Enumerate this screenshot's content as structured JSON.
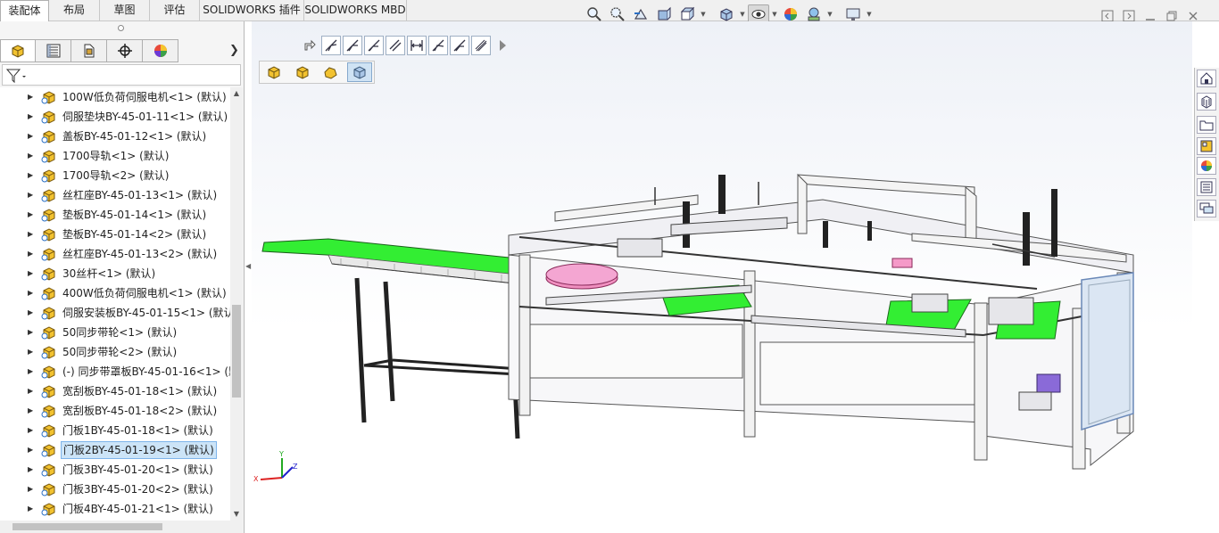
{
  "tabs": [
    {
      "label": "装配体",
      "active": true
    },
    {
      "label": "布局",
      "active": false
    },
    {
      "label": "草图",
      "active": false
    },
    {
      "label": "评估",
      "active": false
    },
    {
      "label": "SOLIDWORKS 插件",
      "active": false
    },
    {
      "label": "SOLIDWORKS MBD",
      "active": false
    }
  ],
  "feature_tree": {
    "items": [
      {
        "label": "100W低负荷伺服电机<1> (默认)",
        "selected": false
      },
      {
        "label": "伺服垫块BY-45-01-11<1> (默认)",
        "selected": false
      },
      {
        "label": "盖板BY-45-01-12<1> (默认)",
        "selected": false
      },
      {
        "label": "1700导轨<1> (默认)",
        "selected": false
      },
      {
        "label": "1700导轨<2> (默认)",
        "selected": false
      },
      {
        "label": "丝杠座BY-45-01-13<1> (默认)",
        "selected": false
      },
      {
        "label": "垫板BY-45-01-14<1> (默认)",
        "selected": false
      },
      {
        "label": "垫板BY-45-01-14<2> (默认)",
        "selected": false
      },
      {
        "label": "丝杠座BY-45-01-13<2> (默认)",
        "selected": false
      },
      {
        "label": "30丝杆<1> (默认)",
        "selected": false
      },
      {
        "label": "400W低负荷伺服电机<1> (默认)",
        "selected": false
      },
      {
        "label": "伺服安装板BY-45-01-15<1> (默认",
        "selected": false
      },
      {
        "label": "50同步带轮<1> (默认)",
        "selected": false
      },
      {
        "label": "50同步带轮<2> (默认)",
        "selected": false
      },
      {
        "label": "(-) 同步带罩板BY-45-01-16<1> (默",
        "selected": false
      },
      {
        "label": "宽刮板BY-45-01-18<1> (默认)",
        "selected": false
      },
      {
        "label": "宽刮板BY-45-01-18<2> (默认)",
        "selected": false
      },
      {
        "label": "门板1BY-45-01-18<1> (默认)",
        "selected": false
      },
      {
        "label": "门板2BY-45-01-19<1> (默认)",
        "selected": true
      },
      {
        "label": "门板3BY-45-01-20<1> (默认)",
        "selected": false
      },
      {
        "label": "门板3BY-45-01-20<2> (默认)",
        "selected": false
      },
      {
        "label": "门板4BY-45-01-21<1> (默认)",
        "selected": false
      }
    ]
  },
  "panel_tabs": [
    "featuremanager-icon",
    "propertymanager-icon",
    "configurationmanager-icon",
    "dimxpert-icon",
    "display-manager-icon"
  ],
  "triad": {
    "x": "X",
    "y": "Y",
    "z": "Z"
  },
  "colors": {
    "accent_green": "#33ee33",
    "frame_white": "#f4f4f4",
    "tab_bg": "#f0f0f0",
    "select_blue": "#cce4f7"
  }
}
